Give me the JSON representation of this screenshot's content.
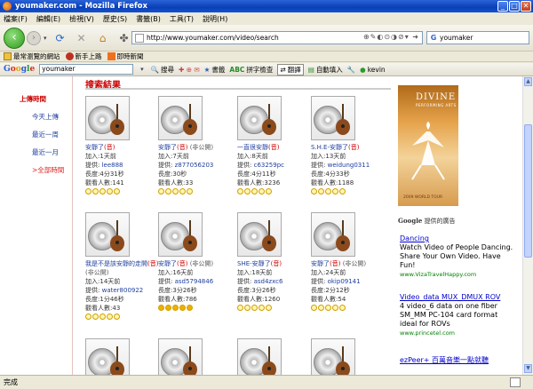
{
  "window": {
    "title": "youmaker.com - Mozilla Firefox"
  },
  "menu": [
    "檔案(F)",
    "編輯(E)",
    "檢視(V)",
    "歷史(S)",
    "書籤(B)",
    "工具(T)",
    "說明(H)"
  ],
  "nav": {
    "url": "http://www.youmaker.com/video/search",
    "search_value": "youmaker",
    "search_engine": "G"
  },
  "bookmarks": [
    "最常瀏覽的網站",
    "新手上路",
    "即時新聞"
  ],
  "google_toolbar": {
    "logo": "Google",
    "query": "youmaker",
    "items": [
      "搜尋",
      "書籤",
      "拼字檢查",
      "翻譯",
      "自動填入",
      "kevin"
    ]
  },
  "sidebar": {
    "heading": "上傳時間",
    "items": [
      {
        "label": "今天上傳",
        "selected": false
      },
      {
        "label": "最近一周",
        "selected": false
      },
      {
        "label": "最近一月",
        "selected": false
      },
      {
        "label": ">全部時間",
        "selected": true
      }
    ]
  },
  "results": {
    "title": "搜索結果",
    "labels": {
      "added": "加入:",
      "provider": "提供:",
      "length": "長度:",
      "views": "觀看人數:"
    },
    "cards": [
      {
        "title": "安靜了",
        "note": "(音)",
        "tag": "",
        "added": "1天前",
        "provider": "lee888",
        "length": "4分31秒",
        "views": "141",
        "stars": 0
      },
      {
        "title": "安靜了",
        "note": "(音)",
        "tag": "(非公開)",
        "added": "7天前",
        "provider": "z877056203",
        "length": "30秒",
        "views": "33",
        "stars": 0
      },
      {
        "title": "一直很安靜",
        "note": "(音)",
        "tag": "",
        "added": "8天前",
        "provider": "c63259pc",
        "length": "4分11秒",
        "views": "3236",
        "stars": 0
      },
      {
        "title": "S.H.E-安靜了",
        "note": "(音)",
        "tag": "",
        "added": "13天前",
        "provider": "weidung0311",
        "length": "4分33秒",
        "views": "1188",
        "stars": 0
      },
      {
        "title": "我是不是該安靜的走開",
        "note": "(音)",
        "tag": "(非公開)",
        "added": "14天前",
        "provider": "water800922",
        "length": "1分46秒",
        "views": "43",
        "stars": 0
      },
      {
        "title": "安靜了",
        "note": "(音)",
        "tag": "(非公開)",
        "added": "16天前",
        "provider": "asd5794846",
        "length": "3分26秒",
        "views": "786",
        "stars": 5
      },
      {
        "title": "SHE-安靜了",
        "note": "(音)",
        "tag": "",
        "added": "18天前",
        "provider": "asd4zxc6",
        "length": "3分26秒",
        "views": "1260",
        "stars": 0
      },
      {
        "title": "安靜了",
        "note": "(音)",
        "tag": "(非公開)",
        "added": "24天前",
        "provider": "okip09141",
        "length": "2分12秒",
        "views": "54",
        "stars": 0
      }
    ]
  },
  "banner": {
    "brand": "DIVINE",
    "sub": "PERFORMING ARTS",
    "tour": "2009 WORLD TOUR"
  },
  "ads": {
    "header_prefix": "Google",
    "header_suffix": "提供的廣告",
    "items": [
      {
        "title": "Dancing",
        "body": "Watch Video of People Dancing. Share Your Own Video. Have Fun!",
        "url": "www.VizaTravelHappy.com"
      },
      {
        "title": "Video_data MUX_DMUX ROV",
        "body": "4 video_6 data on one fiber SM_MM PC-104 card format ideal for ROVs",
        "url": "www.princetel.com"
      },
      {
        "title": "ezPeer+ 百萬音樂一點就聽",
        "body": "",
        "url": ""
      }
    ]
  },
  "status": {
    "text": "完成"
  }
}
